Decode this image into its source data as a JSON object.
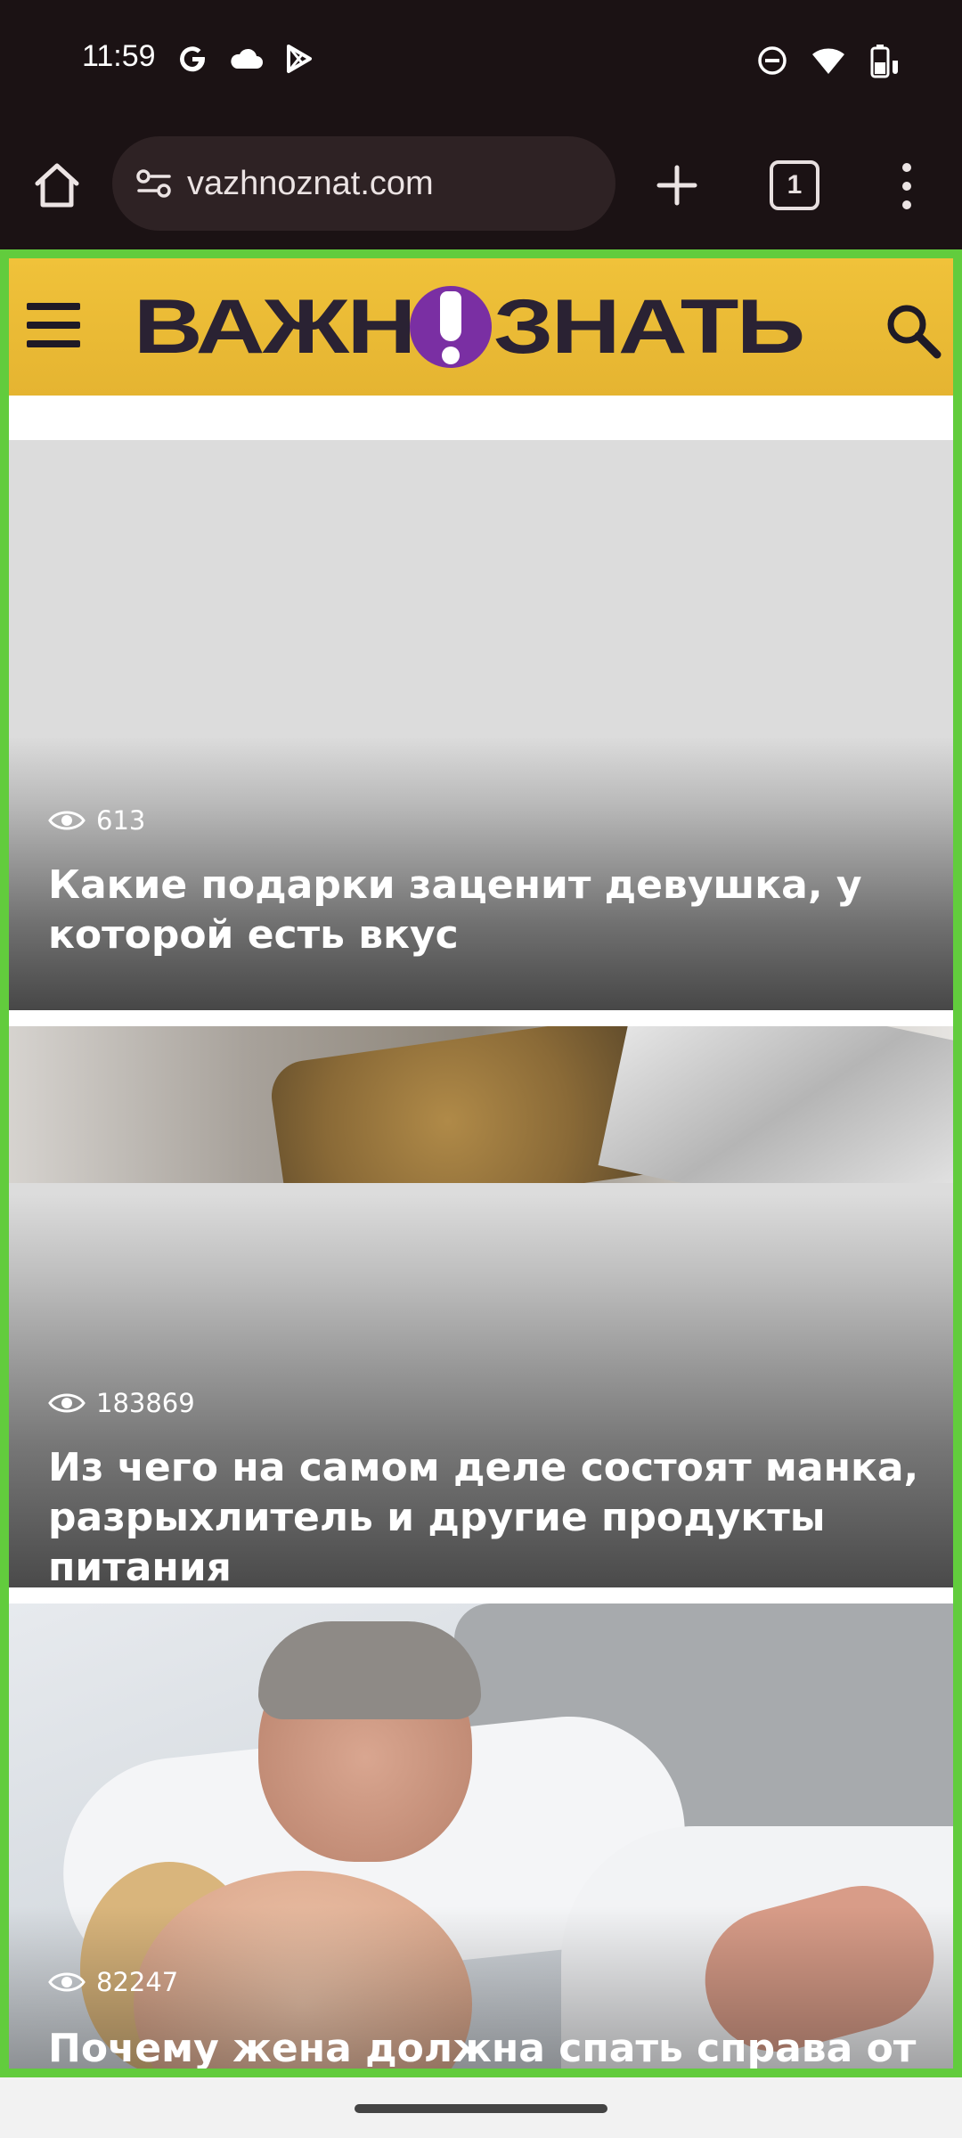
{
  "status_bar": {
    "time": "11:59",
    "left_icons": [
      "google-icon",
      "cloud-icon",
      "play-store-icon"
    ],
    "right_icons": [
      "do-not-disturb-icon",
      "wifi-icon",
      "battery-charging-icon"
    ]
  },
  "browser": {
    "url": "vazhnoznat.com",
    "tab_count": "1",
    "buttons": [
      "home-icon",
      "site-info-icon",
      "new-tab-icon",
      "tab-switcher",
      "more-menu-icon"
    ]
  },
  "site": {
    "logo_left": "ВАЖН",
    "logo_right": "ЗНАТЬ",
    "header_color": "#e8b833",
    "logo_accent": "#7a2fa3"
  },
  "articles": [
    {
      "views": "613",
      "title": "Какие подарки заценит девушка, у которой есть вкус"
    },
    {
      "views": "183869",
      "title": "Из чего на самом деле состоят манка, разрыхлитель и другие продукты питания"
    },
    {
      "views": "82247",
      "title": "Почему жена должна спать справа от"
    }
  ],
  "colors": {
    "browser_chrome": "#1b1214",
    "frame_border": "#62cc3d"
  }
}
